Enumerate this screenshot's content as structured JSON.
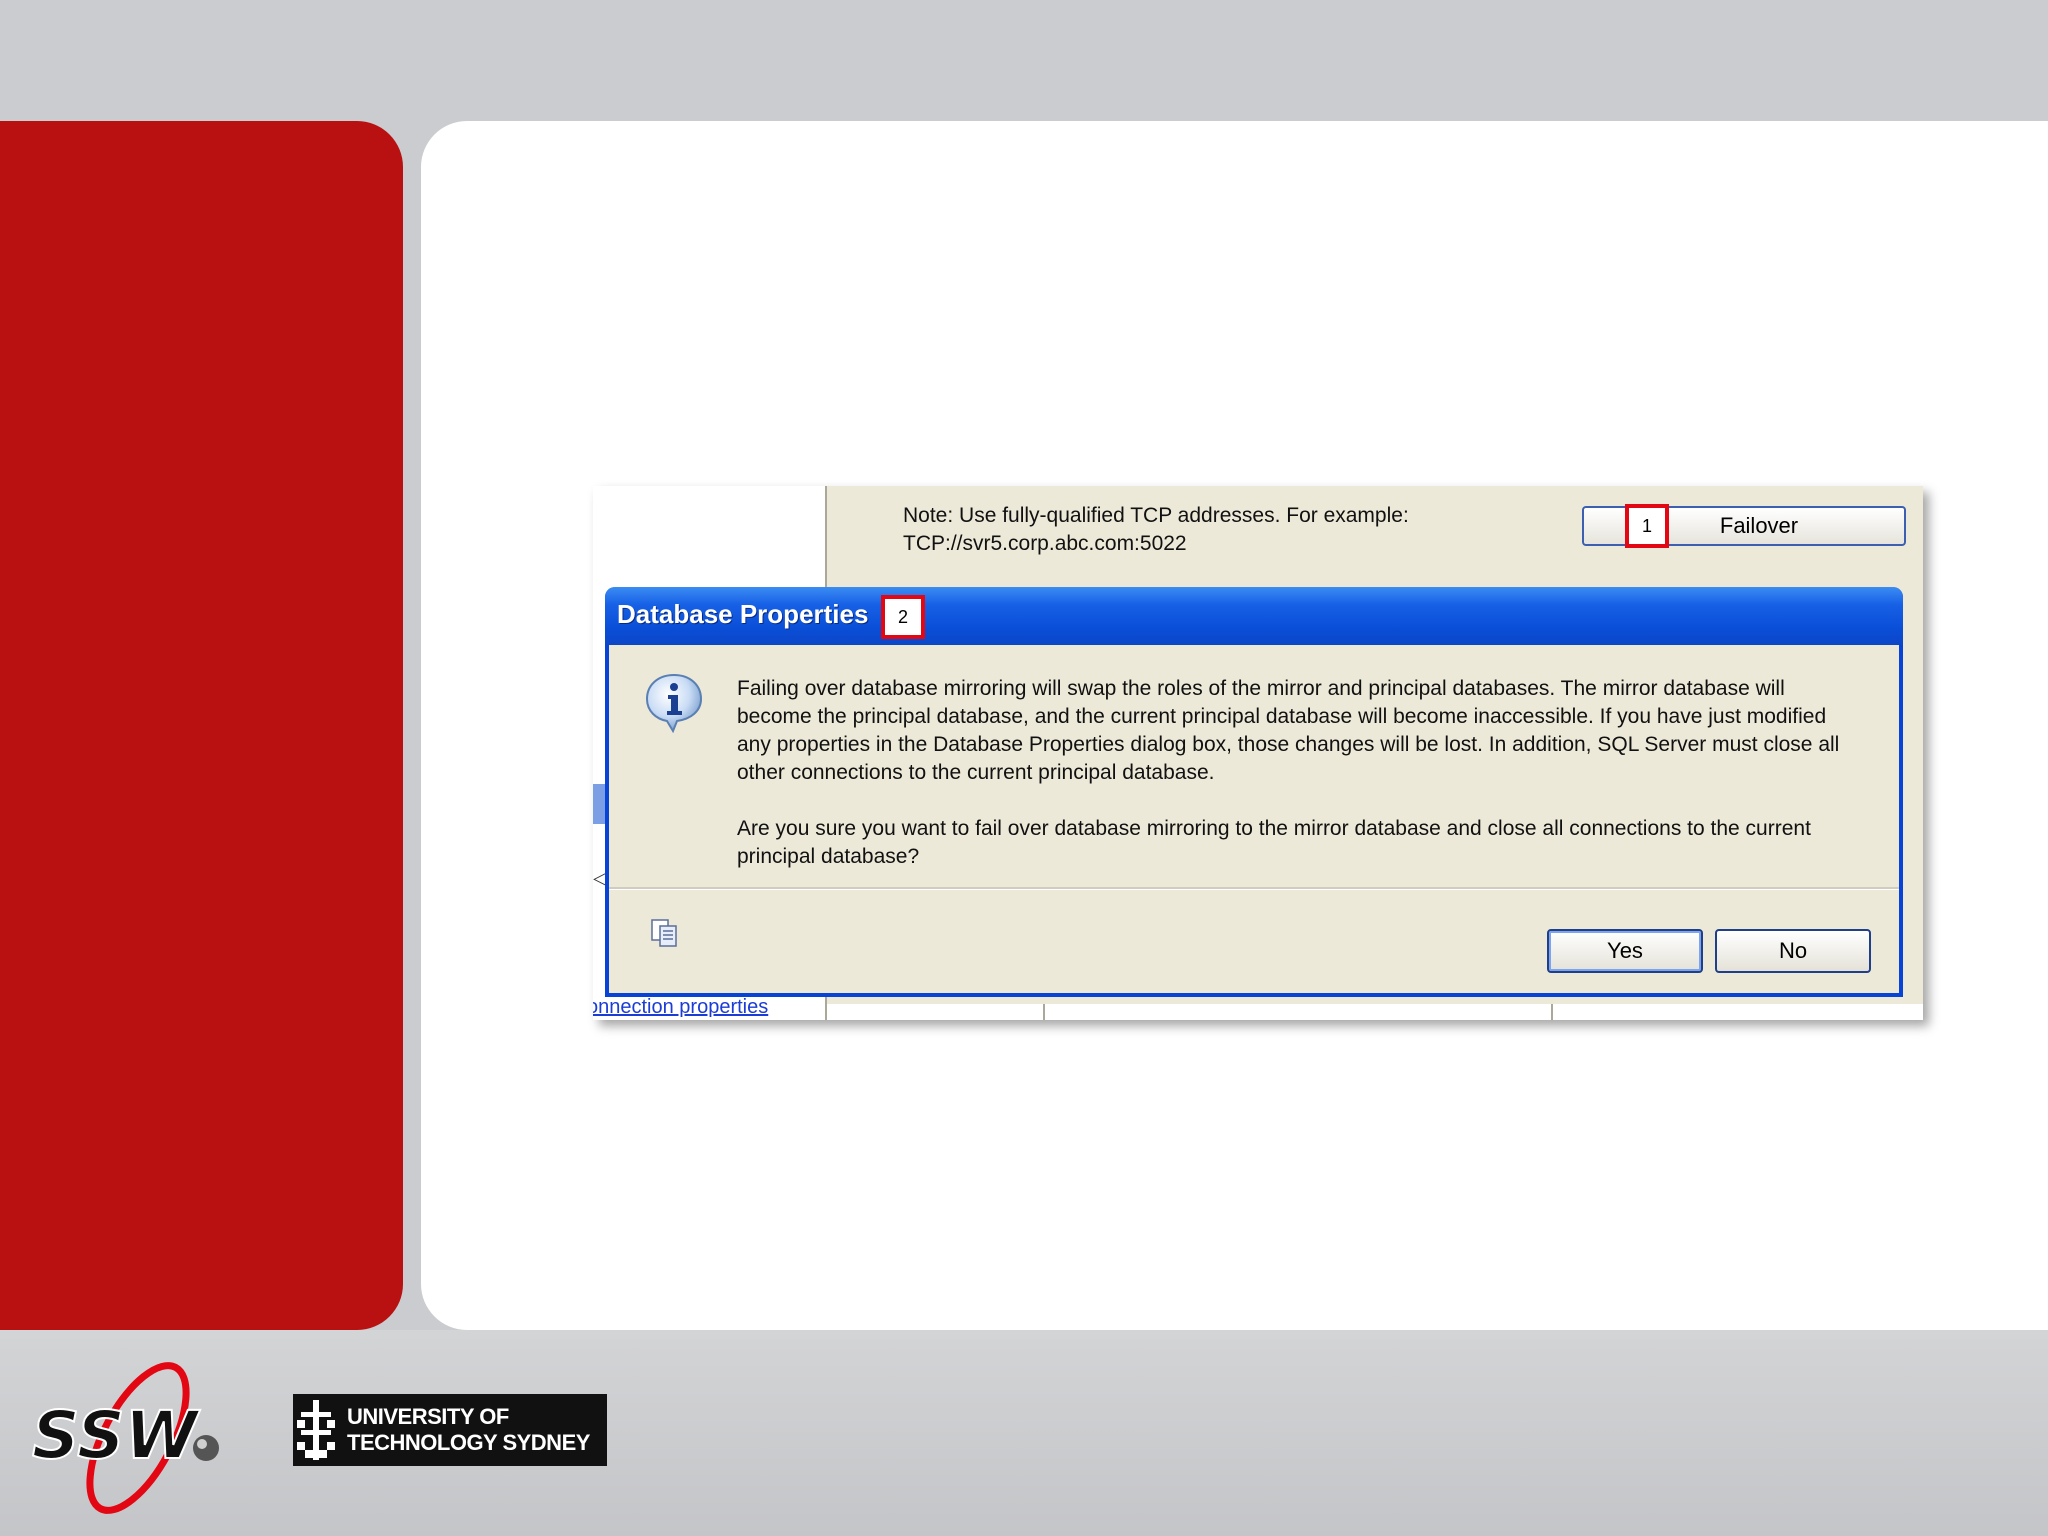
{
  "slide": {
    "colors": {
      "red_panel": "#b91111",
      "white_panel": "#ffffff",
      "background": "#cbcccf"
    }
  },
  "screenshot": {
    "note_line1": "Note: Use fully-qualified TCP addresses. For example:",
    "note_line2": "TCP://svr5.corp.abc.com:5022",
    "failover_label": "Failover",
    "connection_link": "onnection properties",
    "markers": {
      "one": "1",
      "two": "2"
    },
    "dialog": {
      "title": "Database Properties",
      "message_paragraph1": "Failing over database mirroring will swap the roles of the mirror and principal databases. The mirror database will become the principal database, and the current principal database will become inaccessible. If you have just modified any properties in the Database Properties dialog box, those changes will be lost. In addition, SQL Server must close all other connections to the current principal database.",
      "message_paragraph2": "Are you sure you want to fail over database mirroring to the mirror database and close all connections to the current principal database?",
      "yes_label": "Yes",
      "no_label": "No",
      "icons": {
        "info": "info-icon",
        "copy": "copy-icon"
      }
    }
  },
  "logos": {
    "ssw": "SSW",
    "uts_line1": "UNIVERSITY OF",
    "uts_line2": "TECHNOLOGY SYDNEY"
  }
}
